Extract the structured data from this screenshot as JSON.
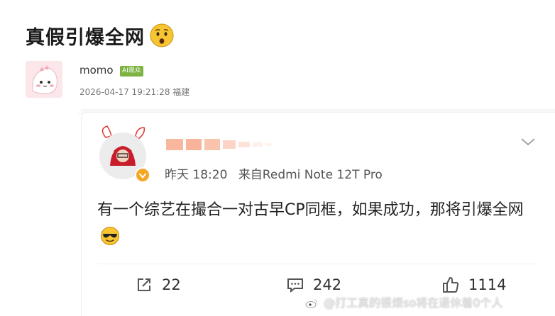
{
  "post": {
    "title": "真假引爆全网",
    "title_emoji": "astonished-face-emoji",
    "author": {
      "name": "momo",
      "badge": "AI观众",
      "meta": "2026-04-17 19:21:28 福建"
    }
  },
  "quoted": {
    "meta_time": "昨天 18:20",
    "meta_source": "来自Redmi Note 12T Pro",
    "content": "有一个综艺在撮合一对古早CP同框，如果成功，那将引爆全网",
    "content_emoji": "smiling-face-with-sunglasses-emoji",
    "verified_badge_color": "#f5a623",
    "actions": {
      "repost_count": "22",
      "comment_count": "242",
      "like_count": "1114"
    }
  },
  "watermark": {
    "text": "@打工真的很烦so将在退休着0个人"
  },
  "colors": {
    "accent_orange": "#f26b3a",
    "ai_badge": "#7cb342"
  }
}
